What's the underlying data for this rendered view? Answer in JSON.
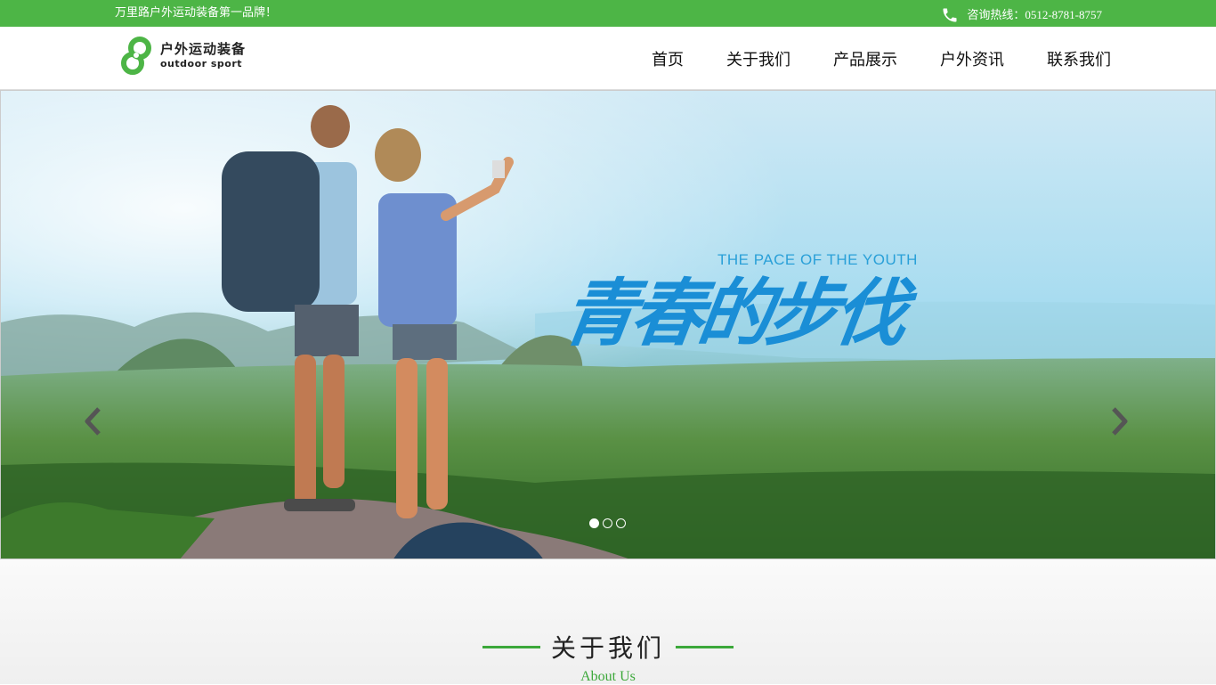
{
  "topbar": {
    "slogan": "万里路户外运动装备第一品牌！",
    "hotline": "咨询热线：0512-8781-8757"
  },
  "header": {
    "logo_cn": "户外运动装备",
    "logo_en": "outdoor sport",
    "nav": [
      "首页",
      "关于我们",
      "产品展示",
      "户外资讯",
      "联系我们"
    ]
  },
  "banner": {
    "slogan_en": "THE PACE OF THE YOUTH",
    "slogan_cn": "青春的步伐",
    "slides": 3,
    "active_slide": 1
  },
  "about": {
    "title": "关于我们",
    "subtitle": "About Us"
  },
  "colors": {
    "brand_green": "#4db546",
    "slogan_blue": "#1a8ed6"
  }
}
